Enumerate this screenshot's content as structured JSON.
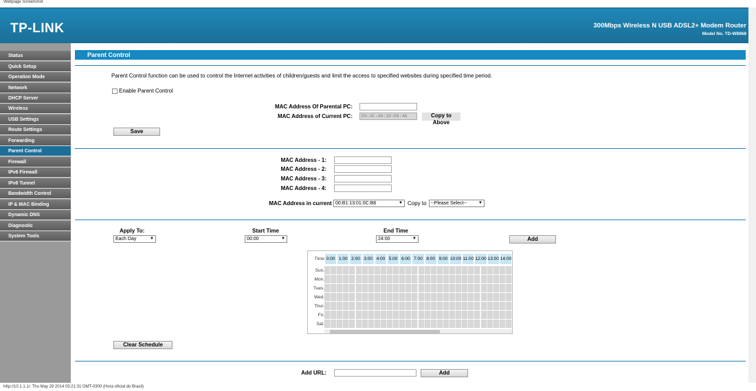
{
  "window": {
    "caption": "Webpage Screenshot"
  },
  "header": {
    "logo": "TP-LINK",
    "product": "300Mbps Wireless N USB ADSL2+ Modem Router",
    "model": "Model No. TD-W8968"
  },
  "sidebar": {
    "items": [
      {
        "label": "Status"
      },
      {
        "label": "Quick Setup"
      },
      {
        "label": "Operation Mode"
      },
      {
        "label": "Network"
      },
      {
        "label": "DHCP Server"
      },
      {
        "label": "Wireless"
      },
      {
        "label": "USB Settings"
      },
      {
        "label": "Route Settings"
      },
      {
        "label": "Forwarding"
      },
      {
        "label": "Parent Control"
      },
      {
        "label": "Firewall"
      },
      {
        "label": "IPv6 Firewall"
      },
      {
        "label": "IPv6 Tunnel"
      },
      {
        "label": "Bandwidth Control"
      },
      {
        "label": "IP & MAC Binding"
      },
      {
        "label": "Dynamic DNS"
      },
      {
        "label": "Diagnostic"
      },
      {
        "label": "System Tools"
      }
    ],
    "active": "Parent Control"
  },
  "page": {
    "title": "Parent Control",
    "description": "Parent Control function can be used to control the Internet activities of children/guests and limit the access to specified websites during specified time period.",
    "enable_label": "Enable Parent Control",
    "mac_parental_label": "MAC Address Of Parental PC:",
    "mac_parental_value": "",
    "mac_current_label": "MAC Address of Current PC:",
    "mac_current_value": "E0:3F:49:19:D8:4A",
    "copy_above_label": "Copy to Above",
    "save_label": "Save",
    "mac_list": [
      {
        "label": "MAC Address - 1:",
        "value": ""
      },
      {
        "label": "MAC Address - 2:",
        "value": ""
      },
      {
        "label": "MAC Address - 3:",
        "value": ""
      },
      {
        "label": "MAC Address - 4:",
        "value": ""
      }
    ],
    "lan_label": "MAC Address in current LAN:",
    "lan_value": "00:B1:13:01:0C:B8",
    "copy_to_label": "Copy to",
    "copy_to_value": "--Please Select--",
    "apply_to_label": "Apply To:",
    "apply_to_value": "Each Day",
    "start_time_label": "Start Time",
    "start_time_value": "00:00",
    "end_time_label": "End Time",
    "end_time_value": "24:00",
    "add_label": "Add",
    "clear_schedule_label": "Clear Schedule",
    "add_url_label": "Add URL:",
    "add_url_value": "",
    "add_url_button": "Add"
  },
  "schedule": {
    "time_label": "Time",
    "hours": [
      "0:00",
      "1:00",
      "2:00",
      "3:00",
      "4:00",
      "5:00",
      "6:00",
      "7:00",
      "8:00",
      "9:00",
      "10:00",
      "11:00",
      "12:00",
      "13:00",
      "14:00"
    ],
    "days": [
      "Sun.",
      "Mon.",
      "Tues.",
      "Wed.",
      "Thur.",
      "Fri.",
      "Sat."
    ]
  },
  "status_bar": {
    "text": "http://10.1.1.1/; Thu May 29 2014 03:21:31 GMT-0300 (Hora oficial do Brasil)"
  }
}
